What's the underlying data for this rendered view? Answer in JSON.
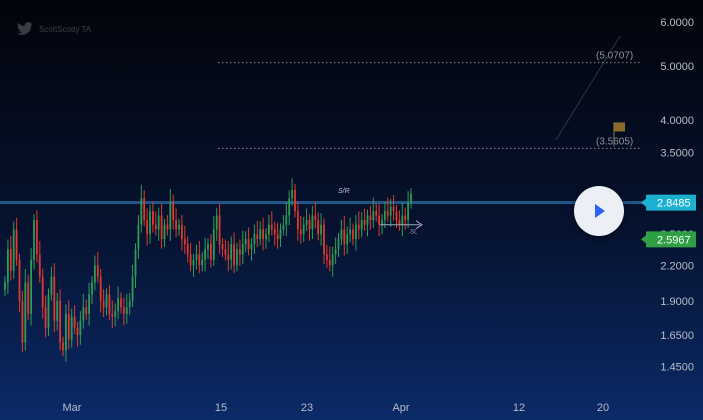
{
  "watermark": {
    "text": "ScottScotty TA",
    "icon": "bird-icon"
  },
  "colors": {
    "up": "#2d9c55",
    "down": "#e3392c",
    "price_badge": "#1bb0cf",
    "low_badge": "#2f9e44",
    "axis_text": "#b7bcc7",
    "fib_line": "#7c8290",
    "support_line": "#2b6fa8"
  },
  "play_button": {
    "icon": "play-icon"
  },
  "chart_data": {
    "type": "candlestick",
    "y_scale": "log",
    "ylim": [
      1.36,
      6.35
    ],
    "y_ticks": [
      "6.0000",
      "5.0000",
      "4.0000",
      "3.5000",
      "2.8000",
      "2.5000",
      "2.2000",
      "1.9000",
      "1.6500",
      "1.4500"
    ],
    "x_ticks": [
      "Mar",
      "15",
      "23",
      "Apr",
      "12",
      "20"
    ],
    "price_labels": [
      {
        "label": "2.8485",
        "value": 2.8485
      },
      {
        "label": "2.5967",
        "value": 2.5967
      }
    ],
    "levels": [
      {
        "label": "(5.0707)",
        "value": 5.0707
      },
      {
        "label": "(3.5605)",
        "value": 3.5605
      }
    ],
    "annotations": [
      {
        "text": "S/R"
      },
      {
        "text": "SL"
      }
    ],
    "candle_closes": [
      2.05,
      2.35,
      2.15,
      2.55,
      2.25,
      1.9,
      1.6,
      2.05,
      1.8,
      2.25,
      2.65,
      2.3,
      2.1,
      1.85,
      1.7,
      1.95,
      2.1,
      1.75,
      1.9,
      1.6,
      1.55,
      1.8,
      1.62,
      1.78,
      1.7,
      1.65,
      1.75,
      1.85,
      1.8,
      1.95,
      2.05,
      2.2,
      2.1,
      1.9,
      1.85,
      1.95,
      1.8,
      1.78,
      1.82,
      1.92,
      1.85,
      1.8,
      1.85,
      1.9,
      2.1,
      2.35,
      2.6,
      2.9,
      2.65,
      2.5,
      2.75,
      2.6,
      2.55,
      2.7,
      2.45,
      2.6,
      2.55,
      2.85,
      2.65,
      2.55,
      2.6,
      2.45,
      2.4,
      2.3,
      2.2,
      2.25,
      2.3,
      2.2,
      2.25,
      2.35,
      2.4,
      2.25,
      2.55,
      2.7,
      2.4,
      2.35,
      2.3,
      2.25,
      2.4,
      2.2,
      2.35,
      2.3,
      2.4,
      2.45,
      2.35,
      2.4,
      2.5,
      2.45,
      2.55,
      2.45,
      2.5,
      2.6,
      2.55,
      2.5,
      2.45,
      2.55,
      2.6,
      2.7,
      2.9,
      3.0,
      2.75,
      2.55,
      2.5,
      2.6,
      2.65,
      2.55,
      2.7,
      2.65,
      2.5,
      2.6,
      2.3,
      2.25,
      2.2,
      2.3,
      2.35,
      2.45,
      2.55,
      2.4,
      2.5,
      2.55,
      2.45,
      2.6,
      2.55,
      2.65,
      2.6,
      2.7,
      2.65,
      2.75,
      2.7,
      2.6,
      2.65,
      2.75,
      2.7,
      2.8,
      2.75,
      2.65,
      2.6,
      2.7,
      2.65,
      2.85,
      2.95
    ]
  }
}
